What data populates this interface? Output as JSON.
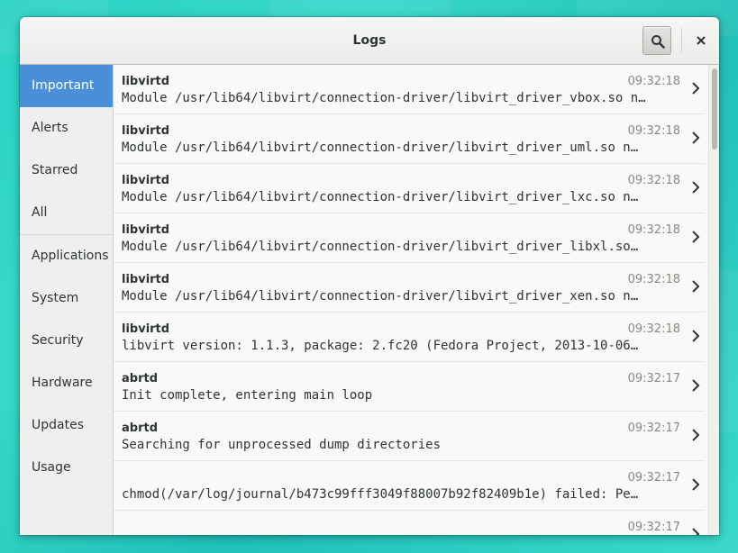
{
  "window": {
    "title": "Logs"
  },
  "sidebar": {
    "items": [
      {
        "label": "Important",
        "active": true
      },
      {
        "label": "Alerts"
      },
      {
        "label": "Starred"
      },
      {
        "label": "All"
      },
      {
        "label": "Applications"
      },
      {
        "label": "System"
      },
      {
        "label": "Security"
      },
      {
        "label": "Hardware"
      },
      {
        "label": "Updates"
      },
      {
        "label": "Usage"
      }
    ]
  },
  "logs": [
    {
      "source": "libvirtd",
      "time": "09:32:18",
      "message": "Module /usr/lib64/libvirt/connection-driver/libvirt_driver_vbox.so n…"
    },
    {
      "source": "libvirtd",
      "time": "09:32:18",
      "message": "Module /usr/lib64/libvirt/connection-driver/libvirt_driver_uml.so n…"
    },
    {
      "source": "libvirtd",
      "time": "09:32:18",
      "message": "Module /usr/lib64/libvirt/connection-driver/libvirt_driver_lxc.so n…"
    },
    {
      "source": "libvirtd",
      "time": "09:32:18",
      "message": "Module /usr/lib64/libvirt/connection-driver/libvirt_driver_libxl.so…"
    },
    {
      "source": "libvirtd",
      "time": "09:32:18",
      "message": "Module /usr/lib64/libvirt/connection-driver/libvirt_driver_xen.so n…"
    },
    {
      "source": "libvirtd",
      "time": "09:32:18",
      "message": "libvirt version: 1.1.3, package: 2.fc20 (Fedora Project, 2013-10-06…"
    },
    {
      "source": "abrtd",
      "time": "09:32:17",
      "message": "Init complete, entering main loop"
    },
    {
      "source": "abrtd",
      "time": "09:32:17",
      "message": "Searching for unprocessed dump directories"
    },
    {
      "source": "",
      "time": "09:32:17",
      "message": "chmod(/var/log/journal/b473c99fff3049f88007b92f82409b1e) failed: Pe…"
    },
    {
      "source": "",
      "time": "09:32:17",
      "message": ""
    }
  ],
  "colors": {
    "accent": "#4a90d9",
    "background": "#2ad3c6"
  },
  "icons": {
    "search": "search-icon",
    "close": "close-icon",
    "row_arrow": "chevron-right-icon"
  }
}
